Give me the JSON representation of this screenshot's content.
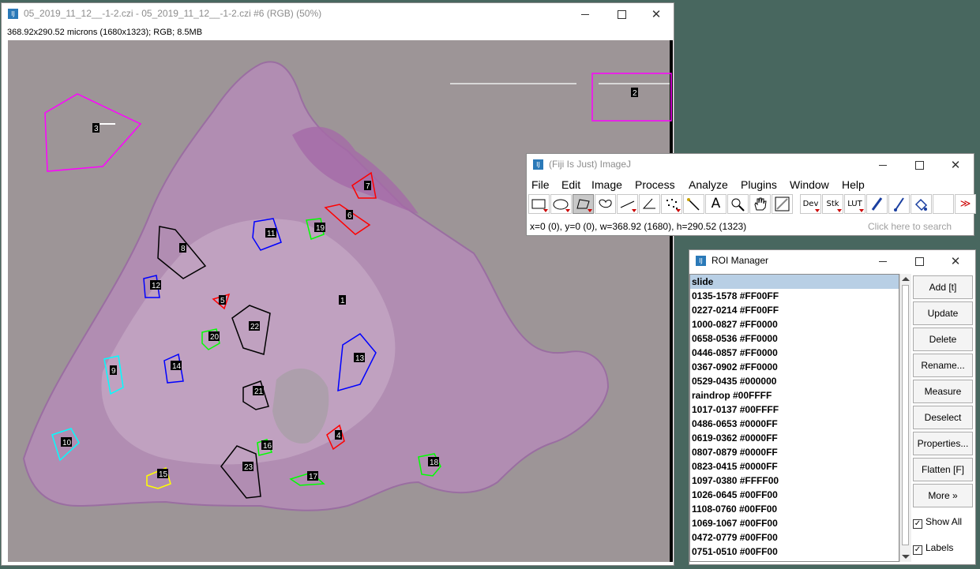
{
  "image_window": {
    "title": "05_2019_11_12__-1-2.czi - 05_2019_11_12__-1-2.czi #6 (RGB) (50%)",
    "info": "368.92x290.52 microns (1680x1323); RGB; 8.5MB",
    "roi_labels": [
      "1",
      "2",
      "3",
      "4",
      "5",
      "6",
      "7",
      "8",
      "9",
      "10",
      "11",
      "12",
      "13",
      "14",
      "15",
      "16",
      "17",
      "18",
      "19",
      "20",
      "21",
      "22",
      "23"
    ]
  },
  "imagej": {
    "title": "(Fiji Is Just) ImageJ",
    "menus": [
      "File",
      "Edit",
      "Image",
      "Process",
      "Analyze",
      "Plugins",
      "Window",
      "Help"
    ],
    "tools": [
      {
        "icon": "rectangle-icon",
        "label": ""
      },
      {
        "icon": "oval-icon",
        "label": ""
      },
      {
        "icon": "polygon-icon",
        "label": ""
      },
      {
        "icon": "freehand-icon",
        "label": ""
      },
      {
        "icon": "line-icon",
        "label": ""
      },
      {
        "icon": "angle-icon",
        "label": ""
      },
      {
        "icon": "point-icon",
        "label": ""
      },
      {
        "icon": "wand-icon",
        "label": ""
      },
      {
        "icon": "text-icon",
        "label": "A"
      },
      {
        "icon": "magnifier-icon",
        "label": ""
      },
      {
        "icon": "hand-icon",
        "label": ""
      },
      {
        "icon": "color-picker-icon",
        "label": ""
      },
      {
        "icon": "dev-icon",
        "label": "Dev"
      },
      {
        "icon": "stk-icon",
        "label": "Stk"
      },
      {
        "icon": "lut-icon",
        "label": "LUT"
      },
      {
        "icon": "pencil-icon",
        "label": ""
      },
      {
        "icon": "brush-icon",
        "label": ""
      },
      {
        "icon": "flood-fill-icon",
        "label": ""
      },
      {
        "icon": "blank-icon",
        "label": ""
      },
      {
        "icon": "more-tools-icon",
        "label": "≫"
      }
    ],
    "status": "x=0 (0), y=0 (0), w=368.92 (1680), h=290.52 (1323)",
    "search_placeholder": "Click here to search"
  },
  "roi_manager": {
    "title": "ROI Manager",
    "items": [
      "slide",
      "0135-1578 #FF00FF",
      "0227-0214 #FF00FF",
      "1000-0827 #FF0000",
      "0658-0536 #FF0000",
      "0446-0857 #FF0000",
      "0367-0902 #FF0000",
      "0529-0435 #000000",
      "raindrop #00FFFF",
      "1017-0137 #00FFFF",
      "0486-0653 #0000FF",
      "0619-0362 #0000FF",
      "0807-0879 #0000FF",
      "0823-0415 #0000FF",
      "1097-0380 #FFFF00",
      "1026-0645 #00FF00",
      "1108-0760 #00FF00",
      "1069-1067 #00FF00",
      "0472-0779 #00FF00",
      "0751-0510 #00FF00"
    ],
    "buttons": [
      "Add [t]",
      "Update",
      "Delete",
      "Rename...",
      "Measure",
      "Deselect",
      "Properties...",
      "Flatten [F]",
      "More »"
    ],
    "show_all": "Show All",
    "labels": "Labels"
  },
  "colors": {
    "magenta": "#FF00FF",
    "red": "#FF0000",
    "black": "#000000",
    "cyan": "#00FFFF",
    "blue": "#0000FF",
    "yellow": "#FFFF00",
    "green": "#00FF00",
    "tissue": "#b98fb9",
    "background": "#9a9294"
  }
}
